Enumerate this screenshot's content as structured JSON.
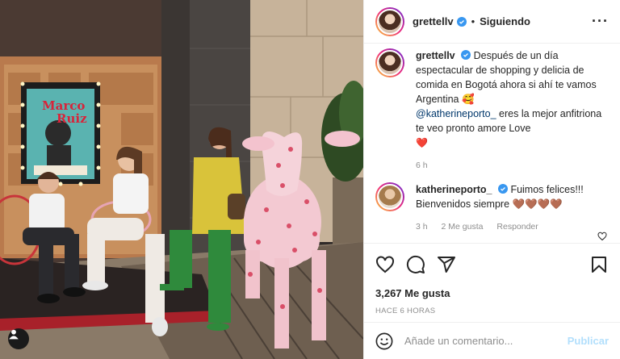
{
  "post": {
    "username": "grettellv",
    "follow_status": "Siguiendo",
    "more_icon": "more-horizontal-icon"
  },
  "photo": {
    "poster_line1": "Marco",
    "poster_line2": "Ruiz"
  },
  "caption": {
    "username": "grettellv",
    "text1": "Después de un día espectacular de shopping y delicia de comida en Bogotá ahora si ahí te vamos Argentina 🥰",
    "mention": "@katherineporto_",
    "text2": " eres la mejor anfitriona te veo pronto amore Love",
    "heart": "❤️",
    "time": "6 h"
  },
  "comments": [
    {
      "username": "katherineporto_",
      "text": "Fuimos felices!!! Bienvenidos siempre 🤎🤎🤎🤎",
      "time": "3 h",
      "likes": "2 Me gusta",
      "reply": "Responder"
    }
  ],
  "stats": {
    "likes": "3,267 Me gusta",
    "ago": "HACE 6 HORAS"
  },
  "composer": {
    "placeholder": "Añade un comentario...",
    "post_label": "Publicar"
  },
  "colors": {
    "verified": "#3897f0",
    "link": "#00376b",
    "post_disabled": "#b2dffc"
  }
}
